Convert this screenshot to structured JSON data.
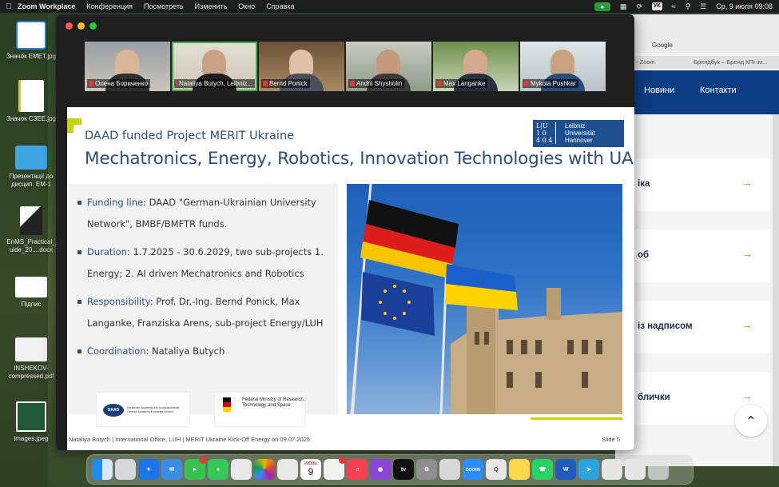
{
  "menubar": {
    "app_name": "Zoom Workplace",
    "menus": [
      "Конференция",
      "Посмотреть",
      "Изменить",
      "Окно",
      "Справка"
    ],
    "keyboard_layout": "УК",
    "clock": "Ср, 9 июля  09:08"
  },
  "desktop": {
    "icons": [
      {
        "label": "Значок EMET.jpg"
      },
      {
        "label": "Значок СЗЕЕ.jpg"
      },
      {
        "label": "Презентації до дисцип. ЕМ-1"
      },
      {
        "label": "EnMS_Practical_ uide_20....docx"
      },
      {
        "label": "Підпис"
      },
      {
        "label": "INSHEKOV-compressed.pdf"
      },
      {
        "label": "images.jpeg"
      }
    ]
  },
  "browser": {
    "tab_google": "Google",
    "tab_zoom": "- Zoom",
    "tab_brand": "Брендбук – Бренд КПІ ім...",
    "nav_items": [
      "Новини",
      "Контакти"
    ],
    "cards": [
      "іка",
      "об",
      "із надписом",
      "блички"
    ],
    "arrow": "→"
  },
  "zoom": {
    "participants": [
      {
        "name": "Олена Бориченко",
        "active": false
      },
      {
        "name": "Nataliya Butych, Leibniz...",
        "active": true
      },
      {
        "name": "Bernd Ponick",
        "active": false
      },
      {
        "name": "Andrii Shysholin",
        "active": false
      },
      {
        "name": "Max Langanke",
        "active": false
      },
      {
        "name": "Mykola Pushkar",
        "active": false
      }
    ]
  },
  "slide": {
    "subtitle": "DAAD funded Project MERIT Ukraine",
    "title": "Mechatronics, Energy, Robotics, Innovation Technologies with UA",
    "luh_logo": {
      "glyph_l1": "L|U",
      "glyph_l2": "1 0",
      "glyph_l3": "4 0 4",
      "line1": "Leibniz",
      "line2": "Universität",
      "line3": "Hannover"
    },
    "bullets": [
      {
        "key": "Funding line",
        "text": ": DAAD \"German-Ukrainian University Network\", BMBF/BMFTR funds."
      },
      {
        "key": "Duration",
        "text": ": 1.7.2025 - 30.6.2029, two sub-projects 1. Energy; 2. AI driven Mechatronics and Robotics"
      },
      {
        "key": "Responsibility",
        "text": ": Prof. Dr.-Ing. Bernd Ponick, Max Langanke, Franziska Arens, sub-project Energy/LUH"
      },
      {
        "key": "Coordination",
        "text": ": Nataliya Butych"
      }
    ],
    "daad_logo": "DAAD",
    "daad_text": "Deutscher Akademischer Austauschdienst German Academic Exchange Service",
    "bmftr_text": "Federal Ministry of Research, Technology and Space",
    "footer": "Nataliya Butych  |   International Office, LUH   |   MERIT Ukraine Kick-Off Energy on 09.07.2025",
    "slide_number": "Slide 5"
  },
  "dock": {
    "calendar_month": "ИЮЛЬ",
    "calendar_day": "9",
    "zoom_label": "zoom",
    "tv_label": "tv"
  }
}
